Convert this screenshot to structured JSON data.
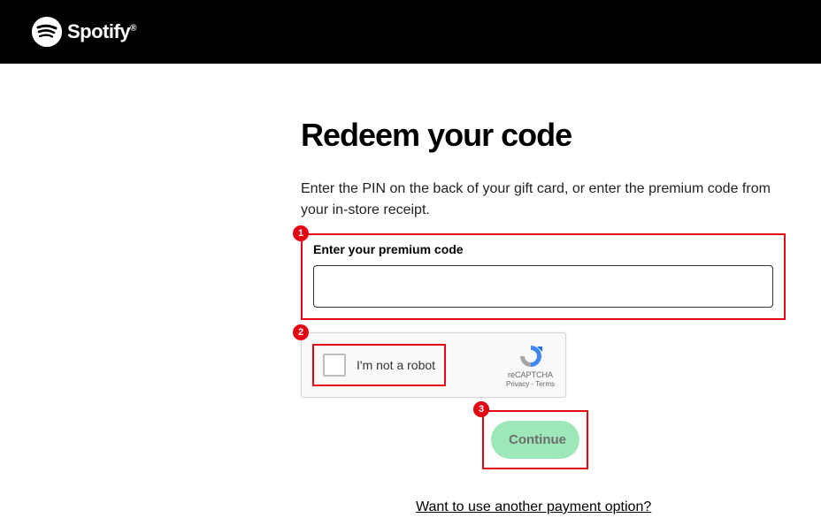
{
  "header": {
    "brand_name": "Spotify"
  },
  "page": {
    "title": "Redeem your code",
    "instructions": "Enter the PIN on the back of your gift card, or enter the premium code from your in-store receipt.",
    "field_label": "Enter your premium code",
    "code_value": ""
  },
  "steps": {
    "one": "1",
    "two": "2",
    "three": "3"
  },
  "captcha": {
    "text": "I'm not a robot",
    "brand": "reCAPTCHA",
    "privacy": "Privacy",
    "terms": "Terms",
    "sep": " - "
  },
  "actions": {
    "continue_label": "Continue",
    "alt_payment": "Want to use another payment option?"
  }
}
